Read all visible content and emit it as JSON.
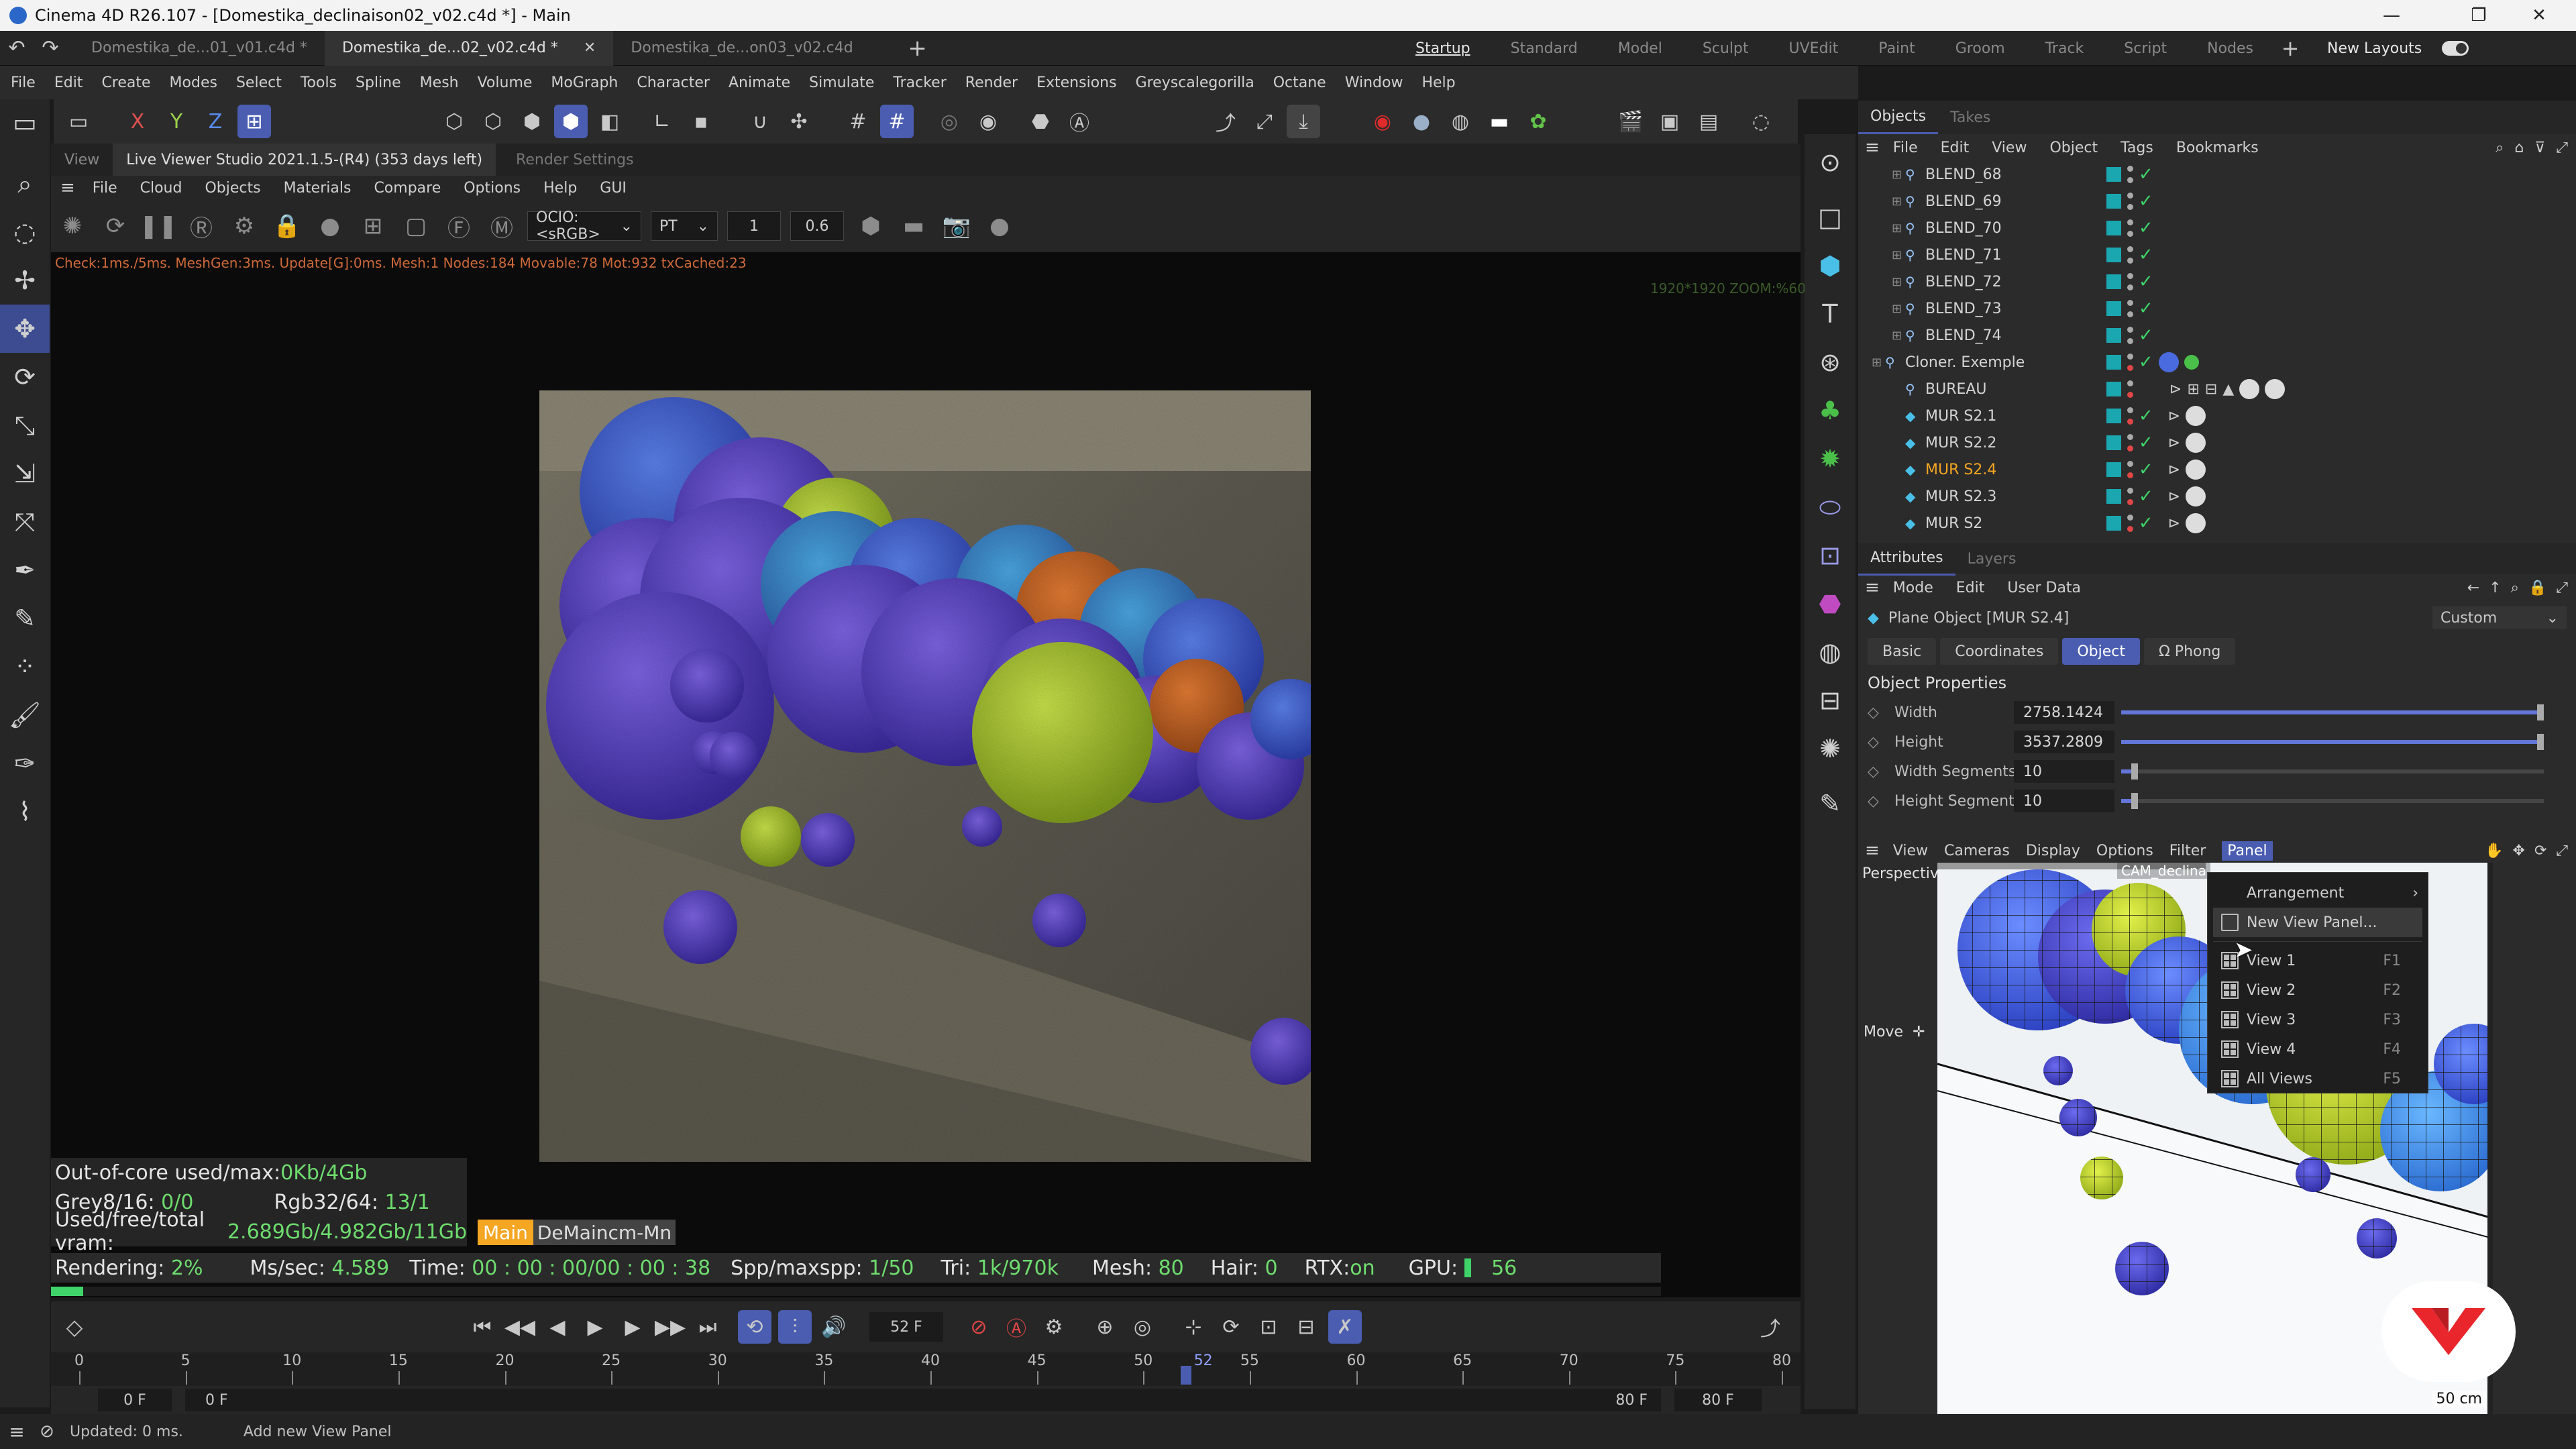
{
  "app": {
    "title": "Cinema 4D R26.107 - [Domestika_declinaison02_v02.c4d *] - Main"
  },
  "doc_tabs": [
    {
      "label": "Domestika_de...01_v01.c4d *",
      "active": false
    },
    {
      "label": "Domestika_de...02_v02.c4d *",
      "active": true
    },
    {
      "label": "Domestika_de...on03_v02.c4d",
      "active": false
    }
  ],
  "layouts": [
    "Startup",
    "Standard",
    "Model",
    "Sculpt",
    "UVEdit",
    "Paint",
    "Groom",
    "Track",
    "Script",
    "Nodes"
  ],
  "new_layouts_label": "New Layouts",
  "menu": [
    "File",
    "Edit",
    "Create",
    "Modes",
    "Select",
    "Tools",
    "Spline",
    "Mesh",
    "Volume",
    "MoGraph",
    "Character",
    "Animate",
    "Simulate",
    "Tracker",
    "Render",
    "Extensions",
    "Greyscalegorilla",
    "Octane",
    "Window",
    "Help"
  ],
  "axis_labels": {
    "x": "X",
    "y": "Y",
    "z": "Z"
  },
  "live_viewer": {
    "tab_view": "View",
    "tab_title": "Live Viewer Studio 2021.1.5-(R4) (353 days left)",
    "tab_render_settings": "Render Settings",
    "menu": [
      "File",
      "Cloud",
      "Objects",
      "Materials",
      "Compare",
      "Options",
      "Help",
      "GUI"
    ],
    "ocio": "OCIO:<sRGB>",
    "kernel": "PT",
    "field1": "1",
    "field2": "0.6",
    "check_line": "Check:1ms./5ms. MeshGen:3ms. Update[G]:0ms. Mesh:1 Nodes:184 Movable:78 Mot:932 txCached:23",
    "zoom_info": "1920*1920 ZOOM:%60"
  },
  "stats": {
    "outofcore_label": "Out-of-core used/max:",
    "outofcore_val": "0Kb/4Gb",
    "grey_label": "Grey8/16:",
    "grey_val": "0/0",
    "rgb_label": "Rgb32/64:",
    "rgb_val": "13/1",
    "vram_label": "Used/free/total vram:",
    "vram_val": "2.689Gb/4.982Gb/11Gb",
    "main_tag": "Main",
    "demain_tag": "DeMaincm-Mn",
    "rendering_label": "Rendering:",
    "rendering_val": "2%",
    "mssec_label": "Ms/sec:",
    "mssec_val": "4.589",
    "time_label": "Time:",
    "time_val": "00 : 00 : 00/00 : 00 : 38",
    "spp_label": "Spp/maxspp:",
    "spp_val": "1/50",
    "tri_label": "Tri:",
    "tri_val": "1k/970k",
    "mesh_label": "Mesh:",
    "mesh_val": "80",
    "hair_label": "Hair:",
    "hair_val": "0",
    "rtx_label": "RTX:",
    "rtx_val": "on",
    "gpu_label": "GPU:",
    "gpu_val": "56",
    "progress": 0.02
  },
  "timeline": {
    "current_frame": "52 F",
    "ticks": [
      "0",
      "5",
      "10",
      "15",
      "20",
      "25",
      "30",
      "35",
      "40",
      "45",
      "50",
      "55",
      "60",
      "65",
      "70",
      "75",
      "80"
    ],
    "playhead": "52",
    "start_a": "0 F",
    "start_b": "0 F",
    "end_a": "80 F",
    "end_b": "80 F"
  },
  "status": {
    "left": "Updated: 0 ms.",
    "right": "Add new View Panel"
  },
  "objects_panel": {
    "tabs": [
      "Objects",
      "Takes"
    ],
    "menu": [
      "File",
      "Edit",
      "View",
      "Object",
      "Tags",
      "Bookmarks"
    ],
    "rows": [
      {
        "name": "BLEND_68",
        "selected": false,
        "check": true
      },
      {
        "name": "BLEND_69",
        "selected": false,
        "check": true
      },
      {
        "name": "BLEND_70",
        "selected": false,
        "check": true
      },
      {
        "name": "BLEND_71",
        "selected": false,
        "check": true
      },
      {
        "name": "BLEND_72",
        "selected": false,
        "check": true
      },
      {
        "name": "BLEND_73",
        "selected": false,
        "check": true
      },
      {
        "name": "BLEND_74",
        "selected": false,
        "check": true
      },
      {
        "name": "Cloner. Exemple",
        "selected": false,
        "check": true
      },
      {
        "name": "BUREAU",
        "selected": false,
        "check": false
      },
      {
        "name": "MUR S2.1",
        "selected": false,
        "check": true
      },
      {
        "name": "MUR S2.2",
        "selected": false,
        "check": true
      },
      {
        "name": "MUR S2.4",
        "selected": true,
        "check": true
      },
      {
        "name": "MUR S2.3",
        "selected": false,
        "check": true
      },
      {
        "name": "MUR S2",
        "selected": false,
        "check": true
      }
    ]
  },
  "attributes": {
    "tabs": [
      "Attributes",
      "Layers"
    ],
    "menu": [
      "Mode",
      "Edit",
      "User Data"
    ],
    "object_title": "Plane Object [MUR S2.4]",
    "preset": "Custom",
    "subtabs": [
      "Basic",
      "Coordinates",
      "Object",
      "Phong"
    ],
    "section": "Object Properties",
    "props": [
      {
        "label": "Width",
        "value": "2758.1424",
        "fill": 1.0
      },
      {
        "label": "Height",
        "value": "3537.2809",
        "fill": 1.0
      },
      {
        "label": "Width Segments",
        "value": "10",
        "fill": 0.04
      },
      {
        "label": "Height Segments",
        "value": "10",
        "fill": 0.04
      }
    ]
  },
  "viewport2": {
    "menu": [
      "View",
      "Cameras",
      "Display",
      "Options",
      "Filter",
      "Panel"
    ],
    "perspective": "Perspective",
    "camera": "CAM_declina",
    "move_label": "Move",
    "scale_label": "50 cm"
  },
  "panel_menu": {
    "arrangement": "Arrangement",
    "new_view_panel": "New View Panel...",
    "views": [
      {
        "label": "View 1",
        "key": "F1"
      },
      {
        "label": "View 2",
        "key": "F2"
      },
      {
        "label": "View 3",
        "key": "F3"
      },
      {
        "label": "View 4",
        "key": "F4"
      },
      {
        "label": "All Views",
        "key": "F5"
      }
    ]
  },
  "colors": {
    "accent": "#4a5db1",
    "green": "#6edc6e",
    "orange": "#f5a623",
    "teal": "#1aa7b0"
  }
}
